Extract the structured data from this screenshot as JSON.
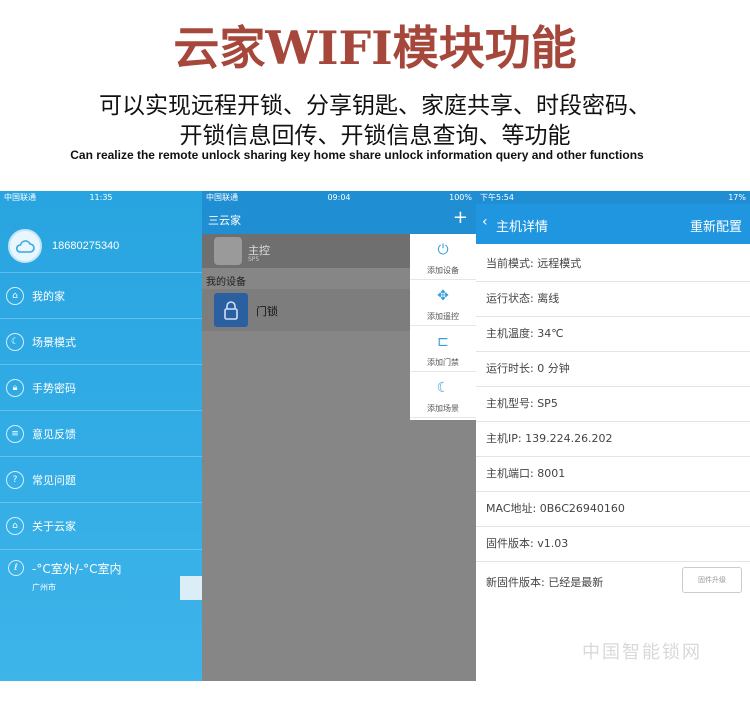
{
  "banner": {
    "title": "云家WIFI模块功能",
    "subtitle_line1": "可以实现远程开锁、分享钥匙、家庭共享、时段密码、",
    "subtitle_line2": "开锁信息回传、开锁信息查询、等功能",
    "english": "Can realize the remote unlock sharing key home share unlock information query and other functions"
  },
  "screen1": {
    "status": {
      "carrier": "中国联通",
      "time": "11:35"
    },
    "phone": "18680275340",
    "menu": [
      {
        "label": "我的家",
        "icon": "home-icon"
      },
      {
        "label": "场景模式",
        "icon": "moon-icon"
      },
      {
        "label": "手势密码",
        "icon": "lock-icon"
      },
      {
        "label": "意见反馈",
        "icon": "feedback-icon"
      },
      {
        "label": "常见问题",
        "icon": "question-icon"
      },
      {
        "label": "关于云家",
        "icon": "info-icon"
      }
    ],
    "weather": {
      "temp": "-°C室外/-°C室内",
      "city": "广州市"
    }
  },
  "screen2": {
    "status": {
      "carrier": "中国联通",
      "time": "09:04",
      "battery": "100%"
    },
    "title": "三云家",
    "plus": "+",
    "host": {
      "name": "主控",
      "sub": "SP5"
    },
    "section": "我的设备",
    "device": "门锁",
    "popup": [
      {
        "label": "添加设备",
        "icon": "power-icon"
      },
      {
        "label": "添加遥控",
        "icon": "remote-icon"
      },
      {
        "label": "添加门禁",
        "icon": "door-icon"
      },
      {
        "label": "添加场景",
        "icon": "moon-icon"
      }
    ]
  },
  "screen3": {
    "status": {
      "time": "下午5:54",
      "battery": "17%"
    },
    "title": "主机详情",
    "action": "重新配置",
    "rows": [
      "当前模式: 远程模式",
      "运行状态: 离线",
      "主机温度: 34℃",
      "运行时长: 0 分钟",
      "主机型号: SP5",
      "主机IP: 139.224.26.202",
      "主机端口: 8001",
      "MAC地址: 0B6C26940160",
      "固件版本: v1.03",
      "新固件版本: 已经是最新"
    ],
    "upgrade_button": "固件升级"
  },
  "watermark": "中国智能锁网"
}
